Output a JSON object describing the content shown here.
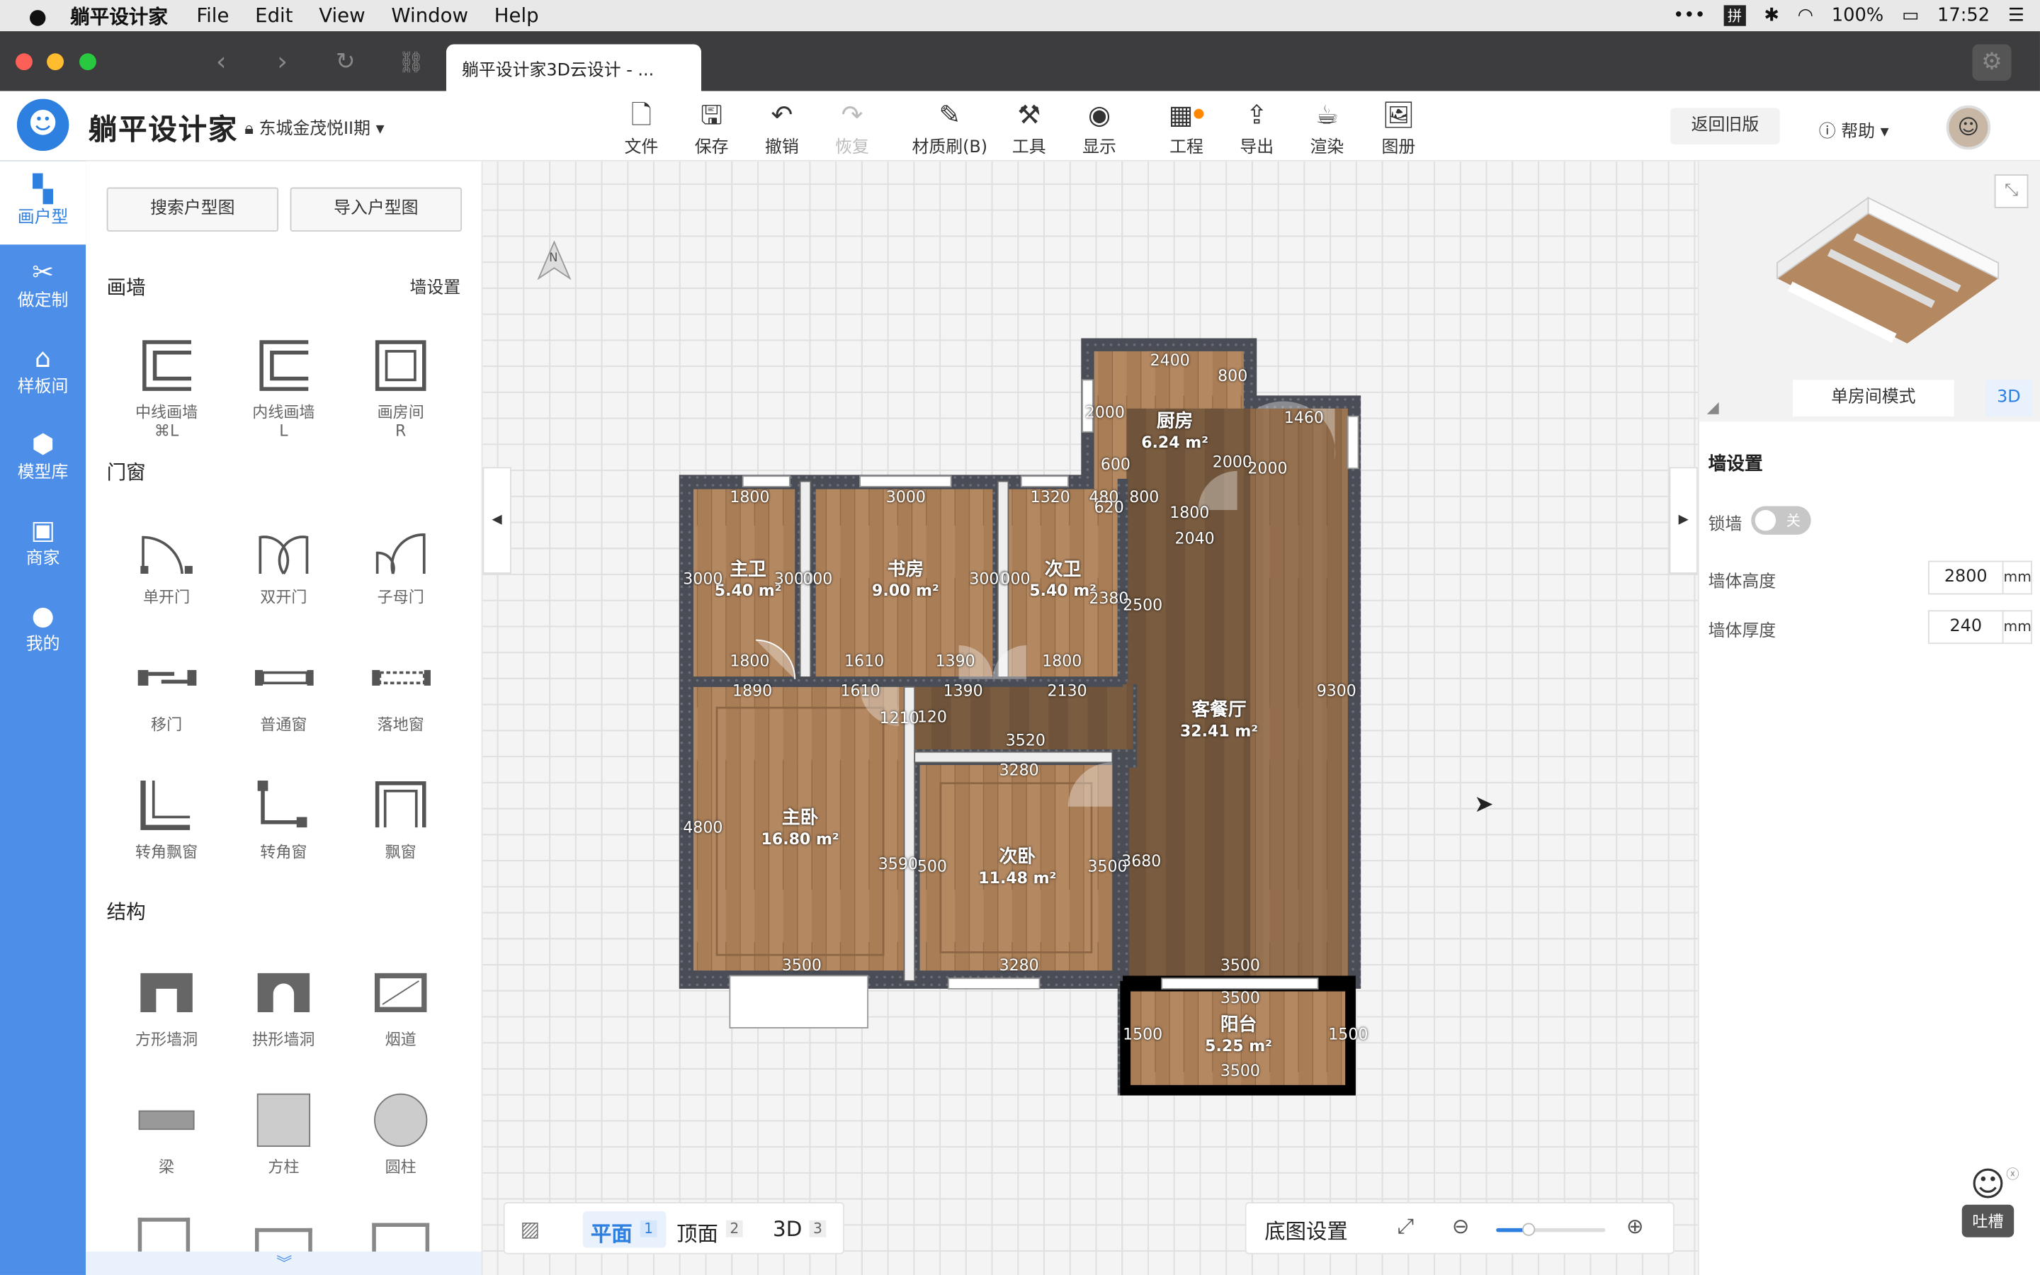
{
  "menubar": {
    "app": "躺平设计家",
    "items": [
      "File",
      "Edit",
      "View",
      "Window",
      "Help"
    ],
    "battery": "100%",
    "clock": "17:52"
  },
  "browser": {
    "tab_title": "躺平设计家3D云设计 - ..."
  },
  "topbar": {
    "brand": "躺平设计家",
    "project": "东城金茂悦II期",
    "tools": [
      {
        "label": "文件",
        "icon": "file-icon"
      },
      {
        "label": "保存",
        "icon": "save-icon"
      },
      {
        "label": "撤销",
        "icon": "undo-icon"
      },
      {
        "label": "恢复",
        "icon": "redo-icon"
      },
      {
        "label": "材质刷(B)",
        "icon": "brush-icon"
      },
      {
        "label": "工具",
        "icon": "toolbox-icon"
      },
      {
        "label": "显示",
        "icon": "eye-icon"
      },
      {
        "label": "工程",
        "icon": "project-icon"
      },
      {
        "label": "导出",
        "icon": "export-icon"
      },
      {
        "label": "渲染",
        "icon": "teapot-icon"
      },
      {
        "label": "图册",
        "icon": "album-icon"
      }
    ],
    "back_old": "返回旧版",
    "help": "帮助"
  },
  "sidebar": {
    "items": [
      "画户型",
      "做定制",
      "样板间",
      "模型库",
      "商家",
      "我的"
    ]
  },
  "panel": {
    "search_btn": "搜索户型图",
    "import_btn": "导入户型图",
    "wall_section": "画墙",
    "wall_settings": "墙设置",
    "wall_items": [
      {
        "label": "中线画墙",
        "key": "⌘L"
      },
      {
        "label": "内线画墙",
        "key": "L"
      },
      {
        "label": "画房间",
        "key": "R"
      }
    ],
    "door_section": "门窗",
    "door_items": [
      "单开门",
      "双开门",
      "子母门",
      "移门",
      "普通窗",
      "落地窗",
      "转角飘窗",
      "转角窗",
      "飘窗"
    ],
    "struct_section": "结构",
    "struct_items": [
      "方形墙洞",
      "拱形墙洞",
      "烟道",
      "梁",
      "方柱",
      "圆柱"
    ]
  },
  "canvas": {
    "compass": "N",
    "view_tabs": [
      {
        "label": "平面",
        "key": "1"
      },
      {
        "label": "顶面",
        "key": "2"
      },
      {
        "label": "3D",
        "key": "3"
      }
    ],
    "base_settings": "底图设置",
    "zoom_level": 0.3,
    "rooms": [
      {
        "name": "厨房",
        "area": "6.24 m²"
      },
      {
        "name": "主卫",
        "area": "5.40 m²"
      },
      {
        "name": "书房",
        "area": "9.00 m²"
      },
      {
        "name": "次卫",
        "area": "5.40 m²"
      },
      {
        "name": "客餐厅",
        "area": "32.41 m²"
      },
      {
        "name": "主卧",
        "area": "16.80 m²"
      },
      {
        "name": "次卧",
        "area": "11.48 m²"
      },
      {
        "name": "阳台",
        "area": "5.25 m²"
      }
    ],
    "dims": [
      "2400",
      "800",
      "2000",
      "600",
      "2000",
      "1800",
      "1460",
      "2000",
      "2040",
      "1800",
      "3000",
      "1320",
      "480",
      "800",
      "620",
      "3000",
      "3000",
      "000",
      "3000",
      "000",
      "2380",
      "2500",
      "1800",
      "1610",
      "1390",
      "1800",
      "1890",
      "1610",
      "1390",
      "2130",
      "1210",
      "120",
      "3520",
      "3280",
      "9300",
      "4800",
      "3590",
      "500",
      "3500",
      "3680",
      "3500",
      "3280",
      "3500",
      "3500",
      "1500",
      "1500",
      "3500"
    ]
  },
  "right": {
    "mode": "单房间模式",
    "btn3d": "3D",
    "title": "墙设置",
    "lock_label": "锁墙",
    "lock_state": "关",
    "height_label": "墙体高度",
    "height": "2800",
    "thick_label": "墙体厚度",
    "thick": "240",
    "unit": "mm",
    "feedback": "吐槽"
  },
  "colors": {
    "accent": "#2d7fe0",
    "sidebar": "#4d8fe8"
  }
}
